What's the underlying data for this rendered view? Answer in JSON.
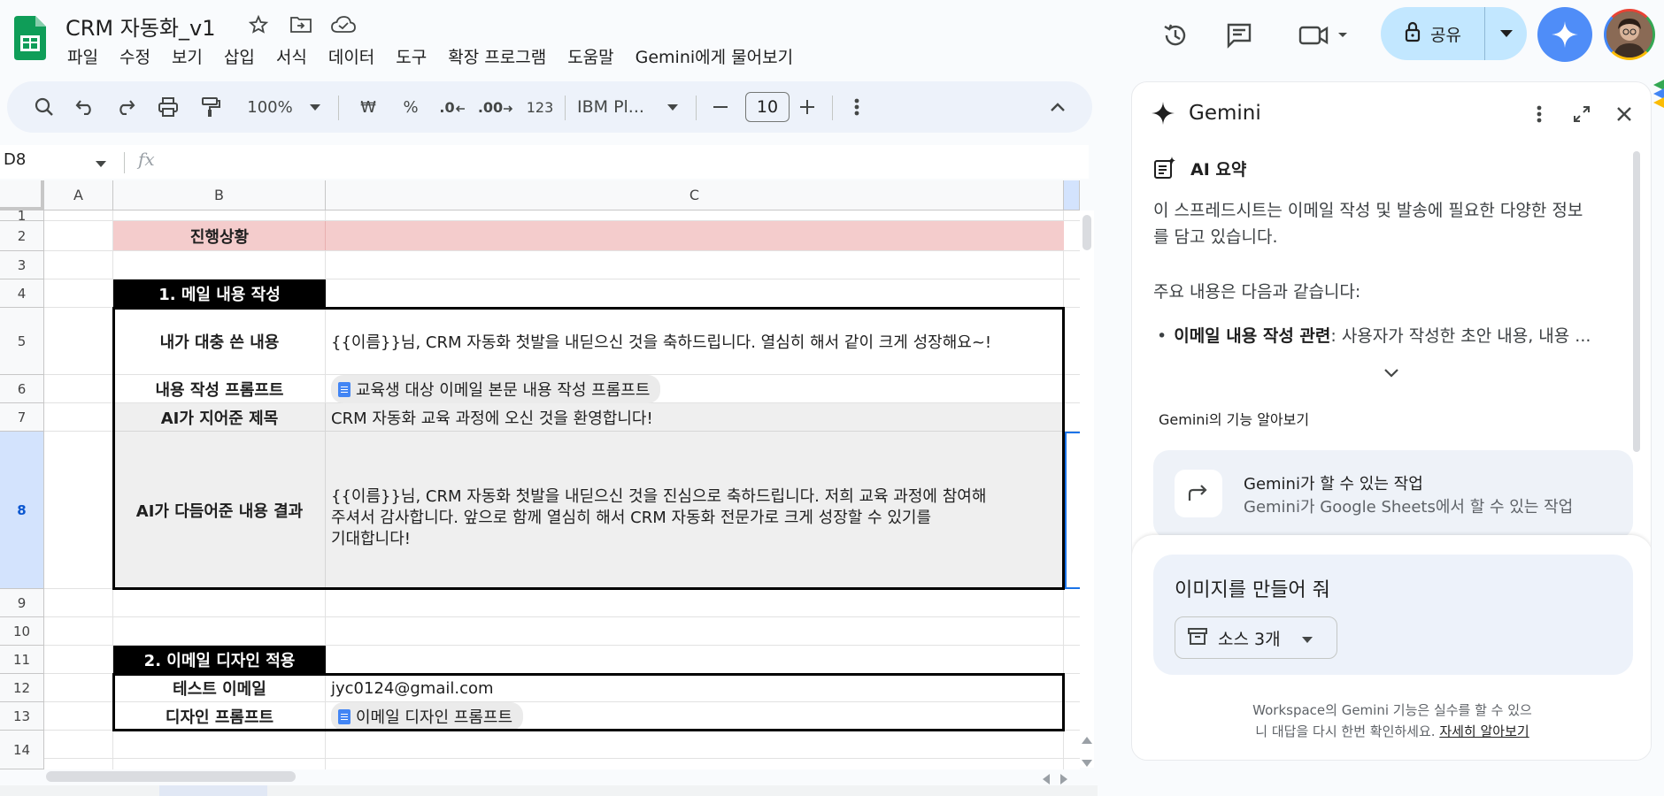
{
  "app": {
    "doc_title": "CRM 자동화_v1",
    "menu": [
      "파일",
      "수정",
      "보기",
      "삽입",
      "서식",
      "데이터",
      "도구",
      "확장 프로그램",
      "도움말",
      "Gemini에게 물어보기"
    ],
    "share_label": "공유"
  },
  "toolbar": {
    "zoom": "100%",
    "currency": "₩",
    "percent": "%",
    "dec_decrease": ".0",
    "dec_increase": ".00",
    "format_123": "123",
    "font": "IBM Pl...",
    "font_size": "10"
  },
  "formula_bar": {
    "cell_ref": "D8",
    "fx": "fx"
  },
  "sheet": {
    "columns": [
      "A",
      "B",
      "C"
    ],
    "rows": [
      "1",
      "2",
      "3",
      "4",
      "5",
      "6",
      "7",
      "8",
      "9",
      "10",
      "11",
      "12",
      "13",
      "14"
    ],
    "status_label": "진행상황",
    "section1_title": "1. 메일 내용 작성",
    "row5_label": "내가 대충 쓴 내용",
    "row5_value": "{{이름}}님, CRM 자동화 첫발을 내딛으신 것을 축하드립니다. 열심히 해서 같이 크게 성장해요~!",
    "row6_label": "내용 작성 프롬프트",
    "row6_chip": "교육생 대상 이메일 본문 내용 작성 프롬프트",
    "row7_label": "AI가 지어준 제목",
    "row7_value": "CRM 자동화 교육 과정에 오신 것을 환영합니다!",
    "row8_label": "AI가 다듬어준 내용 결과",
    "row8_line1": "{{이름}}님, CRM 자동화 첫발을 내딛으신 것을 진심으로 축하드립니다. 저희 교육 과정에 참여해",
    "row8_line2": "주셔서 감사합니다. 앞으로 함께 열심히 해서 CRM 자동화 전문가로 크게 성장할 수 있기를",
    "row8_line3": "기대합니다!",
    "section2_title": "2. 이메일 디자인 적용",
    "row12_label": "테스트 이메일",
    "row12_value": "jyc0124@gmail.com",
    "row13_label": "디자인 프롬프트",
    "row13_chip": "이메일 디자인 프롬프트"
  },
  "gemini": {
    "title": "Gemini",
    "summary_label": "AI 요약",
    "para1_line1": "이 스프레드시트는 이메일 작성 및 발송에 필요한 다양한 정보",
    "para1_line2": "를 담고 있습니다.",
    "para2": "주요 내용은 다음과 같습니다:",
    "bullet_bold": "이메일 내용 작성 관련",
    "bullet_rest": ": 사용자가 작성한 초안 내용, 내용 ...",
    "learn_label": "Gemini의 기능 알아보기",
    "feature_title": "Gemini가 할 수 있는 작업",
    "feature_sub": "Gemini가 Google Sheets에서 할 수 있는 작업",
    "prompt_text": "이미지를 만들어 줘",
    "sources_label": "소스 3개",
    "disclaimer_line1": "Workspace의 Gemini 기능은 실수를 할 수 있으",
    "disclaimer_line2": "니 대답을 다시 한번 확인하세요. ",
    "disclaimer_link": "자세히 알아보기"
  },
  "colors": {
    "accent_blue": "#0b57d0",
    "share_bg": "#c2e7ff",
    "status_row_bg": "#f4cccc",
    "section_header_bg": "#000000",
    "gray_cell": "#efefef"
  }
}
